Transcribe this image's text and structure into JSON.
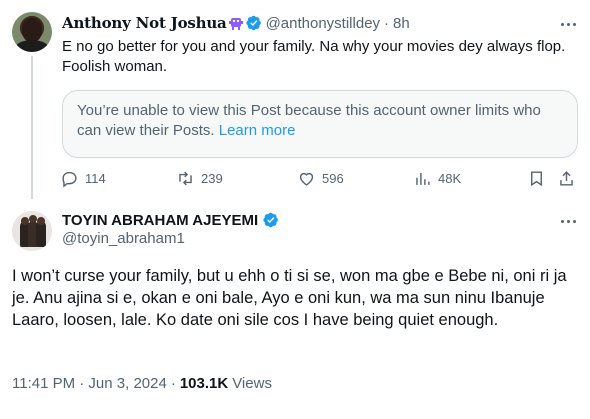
{
  "reply_tweet": {
    "display_name": "Anthony Not Joshua",
    "handle": "@anthonystilldey",
    "separator": "·",
    "time_ago": "8h",
    "text": "E no go better for you and your family. Na why your movies dey always flop. Foolish woman.",
    "unavailable_notice": "You’re unable to view this Post because this account owner limits who can view their Posts.",
    "learn_more": "Learn more",
    "stats": {
      "replies": "114",
      "reposts": "239",
      "likes": "596",
      "views": "48K"
    },
    "icons": [
      "alien-emoji-icon",
      "verified-badge-icon",
      "more-options-icon",
      "reply-icon",
      "repost-icon",
      "like-icon",
      "views-icon",
      "bookmark-icon",
      "share-icon"
    ]
  },
  "main_tweet": {
    "display_name": "TOYIN ABRAHAM AJEYEMI",
    "handle": "@toyin_abraham1",
    "text": "I won’t curse your family, but u ehh o ti si se, won ma gbe e Bebe ni, oni ri ja je. Anu ajina si e, okan e oni bale, Ayo e oni kun, wa ma sun ninu Ibanuje Laaro, loosen, lale. Ko date oni sile cos I have being quiet enough.",
    "timestamp": "11:41 PM · Jun 3, 2024",
    "separator": "·",
    "views_count": "103.1K",
    "views_label": "Views",
    "icons": [
      "verified-badge-icon",
      "more-options-icon"
    ]
  },
  "colors": {
    "text_primary": "#0f1419",
    "text_secondary": "#536471",
    "accent_blue": "#1d9bf0",
    "border": "#cfd9de"
  }
}
